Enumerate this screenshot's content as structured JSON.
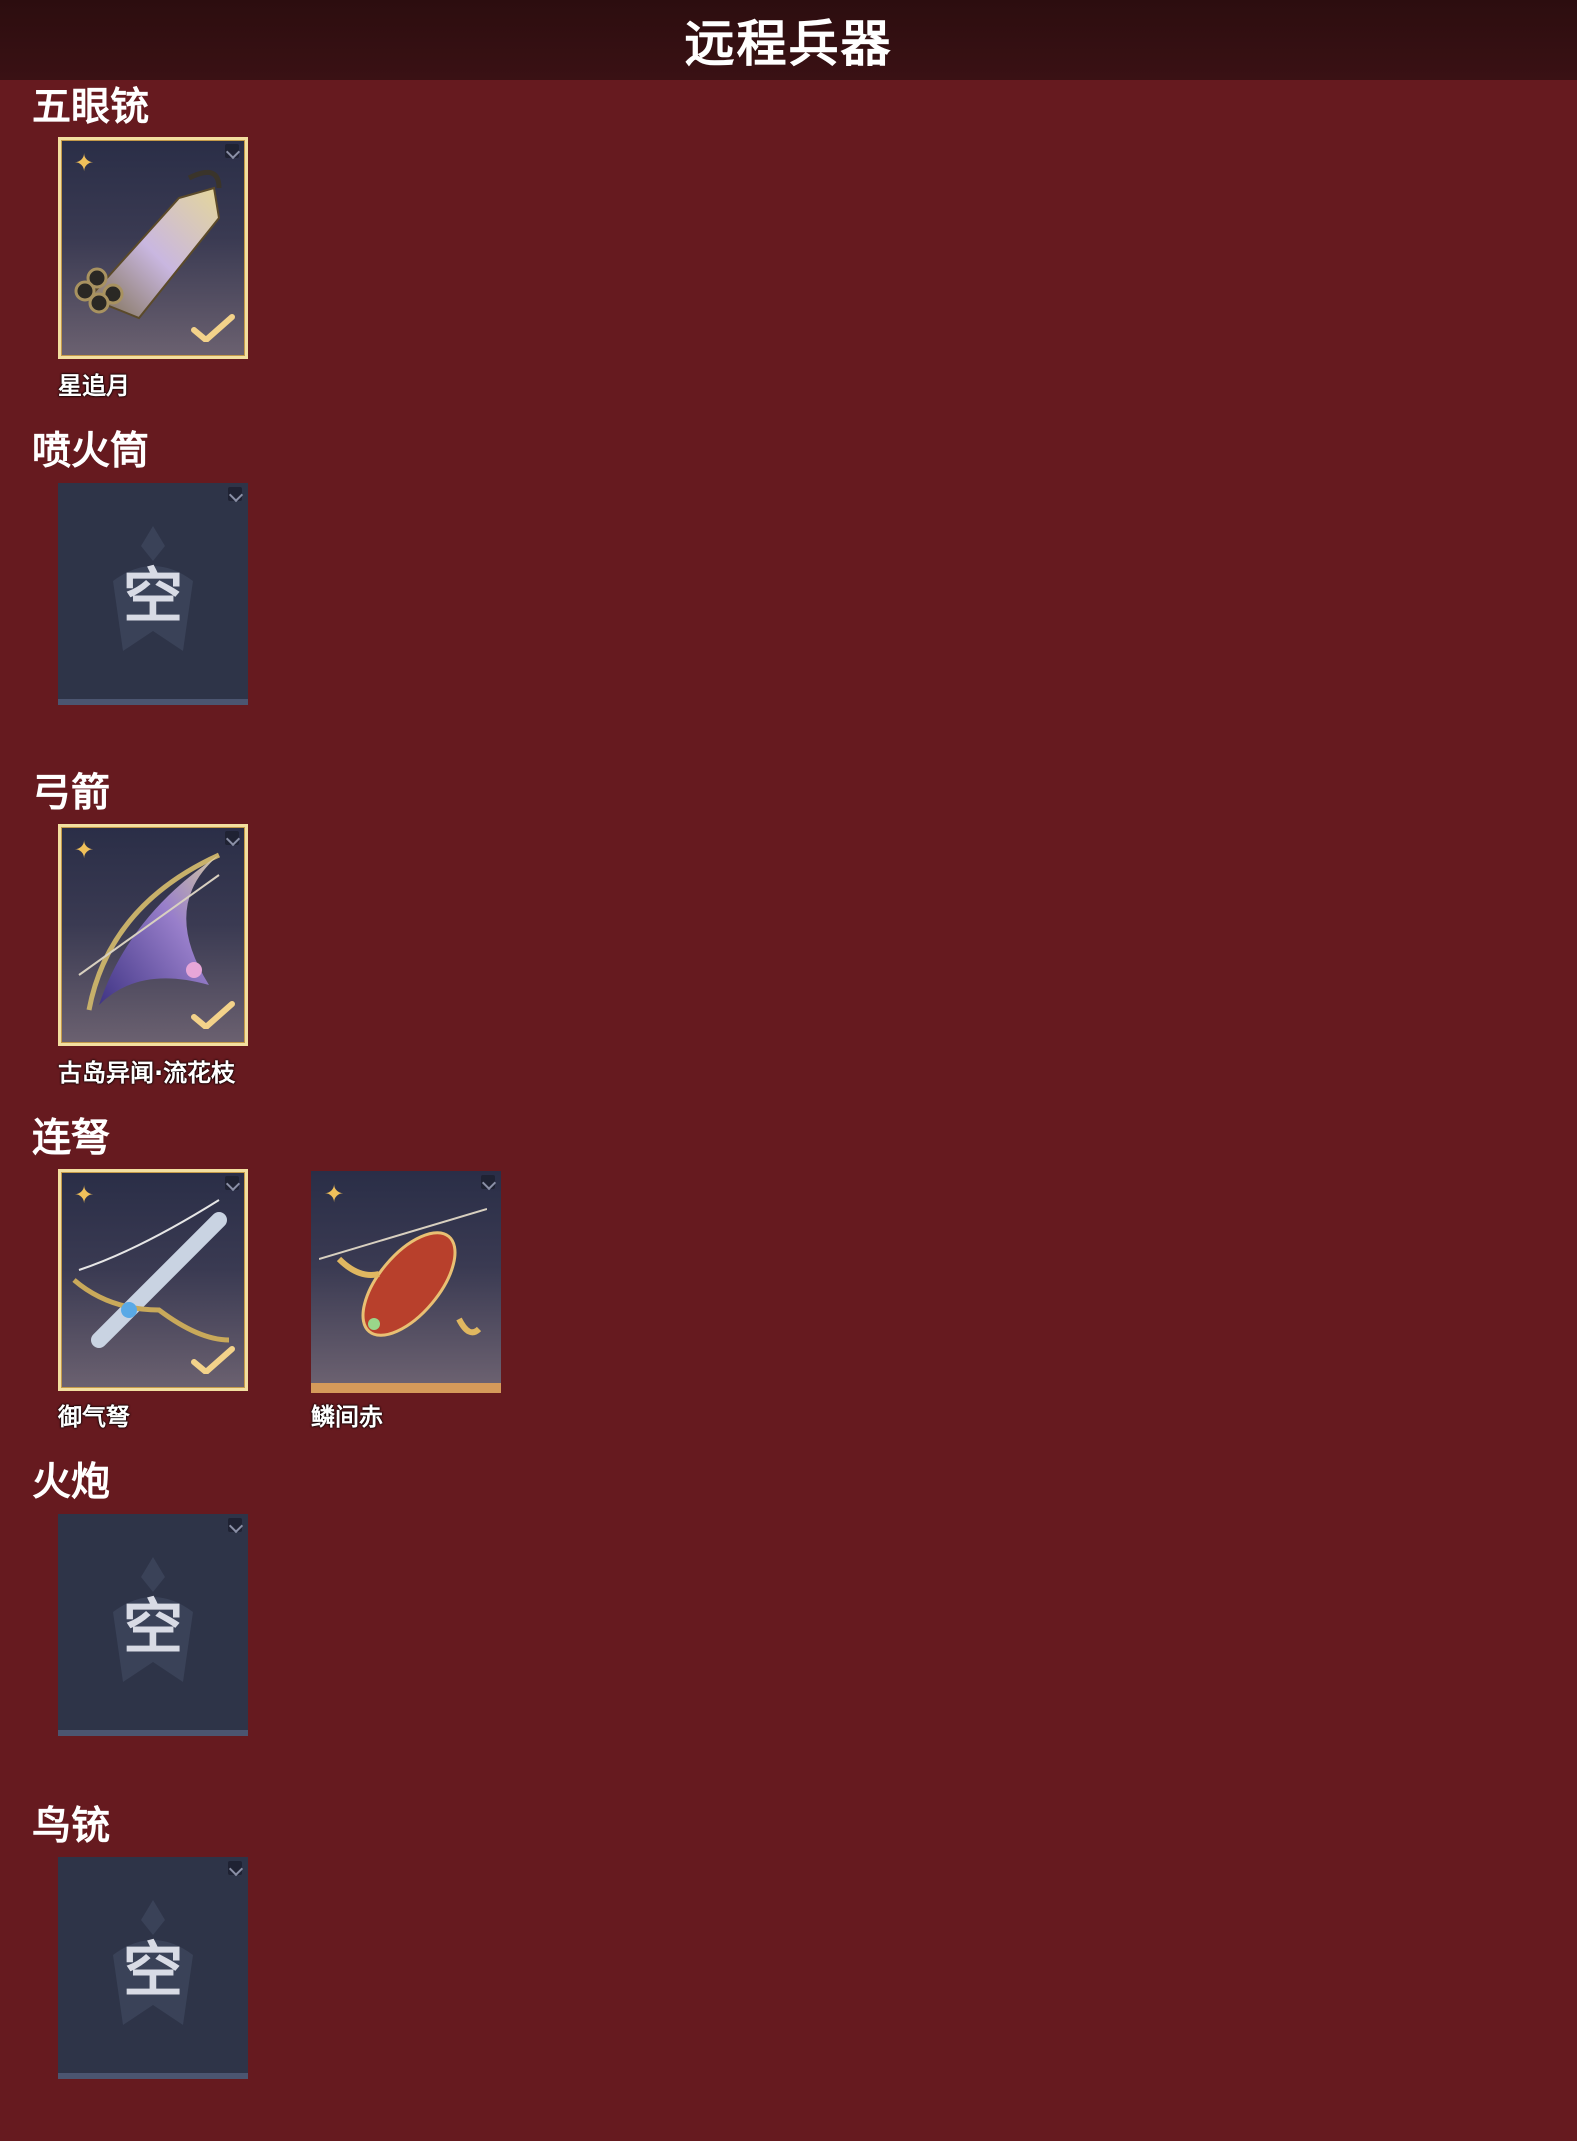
{
  "header": {
    "title": "远程兵器"
  },
  "sections": [
    {
      "title": "五眼铳",
      "items": [
        {
          "name": "星追月",
          "state": "equipped"
        }
      ]
    },
    {
      "title": "喷火筒",
      "items": [
        {
          "empty_label": "空",
          "state": "empty"
        }
      ]
    },
    {
      "title": "弓箭",
      "items": [
        {
          "name": "古岛异闻·流花枝",
          "state": "equipped"
        }
      ]
    },
    {
      "title": "连弩",
      "items": [
        {
          "name": "御气弩",
          "state": "equipped"
        },
        {
          "name": "鳞间赤",
          "state": "owned"
        }
      ]
    },
    {
      "title": "火炮",
      "items": [
        {
          "empty_label": "空",
          "state": "empty"
        }
      ]
    },
    {
      "title": "鸟铳",
      "items": [
        {
          "empty_label": "空",
          "state": "empty"
        }
      ]
    }
  ],
  "icons": {
    "rarity": "rarity-star-icon",
    "equipped": "checkmark-icon",
    "corner": "corner-tag-icon",
    "empty_emblem": "emblem-icon"
  },
  "colors": {
    "background": "#661a1f",
    "header": "#2c0d0f",
    "equipped_border": "#f3dfa0",
    "rarity": "#f0c05a",
    "owned_bar": "#d59a5a",
    "empty_slot": "#2e3448"
  }
}
